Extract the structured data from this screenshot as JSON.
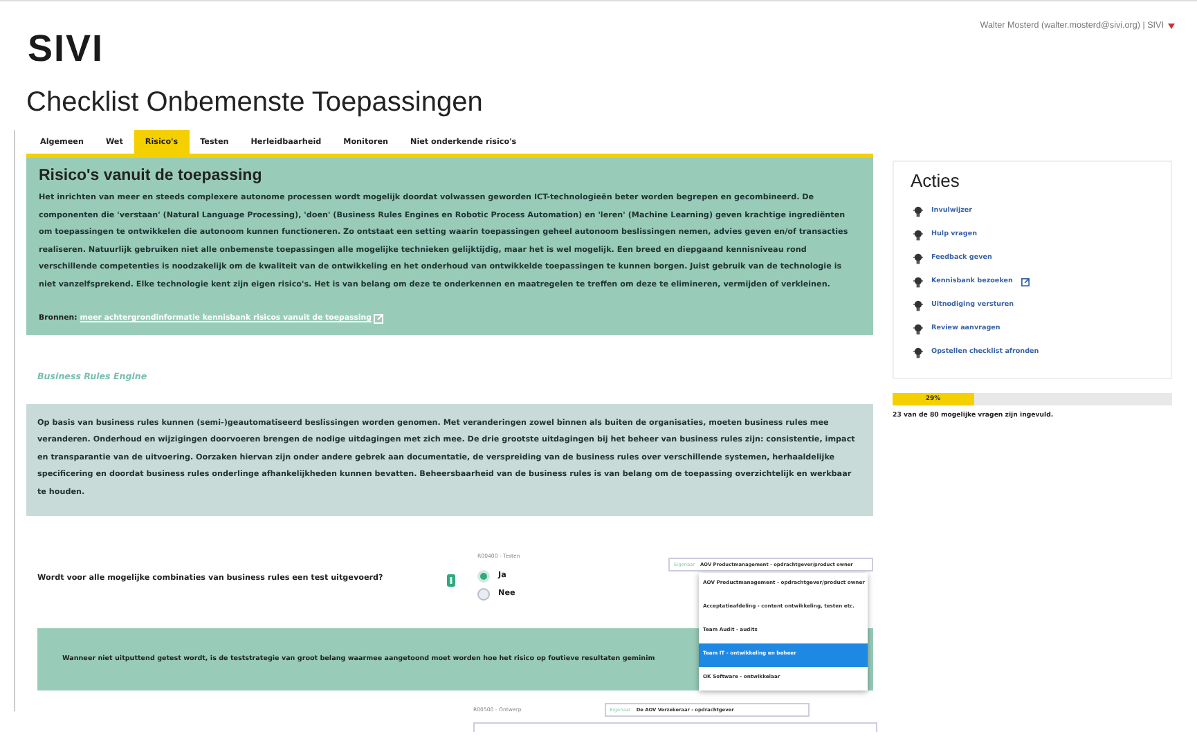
{
  "header": {
    "logo": "SIVI",
    "user": "Walter Mosterd (walter.mosterd@sivi.org) | SIVI"
  },
  "title": "Checklist Onbemenste Toepassingen",
  "tabs": [
    {
      "label": "Algemeen",
      "selected": false
    },
    {
      "label": "Wet",
      "selected": false
    },
    {
      "label": "Risico's",
      "selected": true
    },
    {
      "label": "Testen",
      "selected": false
    },
    {
      "label": "Herleidbaarheid",
      "selected": false
    },
    {
      "label": "Monitoren",
      "selected": false
    },
    {
      "label": "Niet onderkende risico's",
      "selected": false
    }
  ],
  "intro": {
    "heading": "Risico's vanuit de toepassing",
    "text": "Het inrichten van meer en steeds complexere autonome processen wordt mogelijk doordat volwassen geworden ICT-technologieën beter worden begrepen en gecombineerd. De componenten die 'verstaan' (Natural Language Processing), 'doen' (Business Rules Engines en Robotic Process Automation) en 'leren' (Machine Learning) geven krachtige ingrediënten om toepassingen te ontwikkelen die autonoom kunnen functioneren. Zo ontstaat een setting waarin toepassingen geheel autonoom beslissingen nemen, advies geven en/of transacties realiseren. Natuurlijk gebruiken niet alle onbemenste toepassingen alle mogelijke technieken gelijktijdig, maar het is wel mogelijk. Een breed en diepgaand kennisniveau rond verschillende competenties is noodzakelijk om de kwaliteit van de ontwikkeling en het onderhoud van ontwikkelde toepassingen te kunnen borgen. Juist gebruik van de technologie is niet vanzelfsprekend. Elke technologie kent zijn eigen risico's. Het is van belang om deze te onderkennen en maatregelen te treffen om deze te elimineren, vermijden of verkleinen.",
    "sources_label": "Bronnen:",
    "sources_link": "meer achtergrondinformatie kennisbank risicos vanuit de toepassing"
  },
  "section": {
    "title": "Business Rules Engine",
    "text": "Op basis van business rules kunnen (semi-)geautomatiseerd beslissingen worden genomen. Met veranderingen zowel binnen als buiten de organisaties, moeten business rules mee veranderen. Onderhoud en wijzigingen doorvoeren brengen de nodige uitdagingen met zich mee. De drie grootste uitdagingen bij het beheer van business rules zijn: consistentie, impact en transparantie van de uitvoering. Oorzaken hiervan zijn onder andere gebrek aan documentatie, de verspreiding van de business rules over verschillende systemen, herhaaldelijke specificering en doordat business rules onderlinge afhankelijkheden kunnen bevatten. Beheersbaarheid van de business rules is van belang om de toepassing overzichtelijk en werkbaar te houden."
  },
  "question": {
    "code": "R00400 - Testen",
    "text": "Wordt voor alle mogelijke combinaties van business rules een test uitgevoerd?",
    "options": [
      {
        "label": "Ja",
        "selected": true
      },
      {
        "label": "Nee",
        "selected": false
      }
    ],
    "owner_label": "Eigenaar",
    "owner": "AOV Productmanagement - opdrachtgever/product owner",
    "dropdown": [
      {
        "label": "AOV Productmanagement - opdrachtgever/product owner",
        "selected": false
      },
      {
        "label": "Acceptatieafdeling - content ontwikkeling, testen etc.",
        "selected": false
      },
      {
        "label": "Team Audit - audits",
        "selected": false
      },
      {
        "label": "Team IT - ontwikkeling en beheer",
        "selected": true
      },
      {
        "label": "OK Software - ontwikkelaar",
        "selected": false
      }
    ],
    "note": "Wanneer niet uitputtend getest wordt, is de teststrategie van groot belang waarmee aangetoond moet worden hoe het risico op foutieve resultaten geminim"
  },
  "next_question": {
    "code": "R00500 - Ontwerp",
    "owner_label": "Eigenaar",
    "owner": "De AOV Verzekeraar - opdrachtgever"
  },
  "sidebar": {
    "title": "Acties",
    "actions": [
      {
        "label": "Invulwijzer",
        "external": false
      },
      {
        "label": "Hulp vragen",
        "external": false
      },
      {
        "label": "Feedback geven",
        "external": false
      },
      {
        "label": "Kennisbank bezoeken",
        "external": true
      },
      {
        "label": "Uitnodiging versturen",
        "external": false
      },
      {
        "label": "Review aanvragen",
        "external": false
      },
      {
        "label": "Opstellen checklist afronden",
        "external": false
      }
    ],
    "progress": {
      "level": 0.29,
      "label": "29%"
    },
    "progress_text": "23 van de 80 mogelijke vragen zijn ingevuld."
  }
}
